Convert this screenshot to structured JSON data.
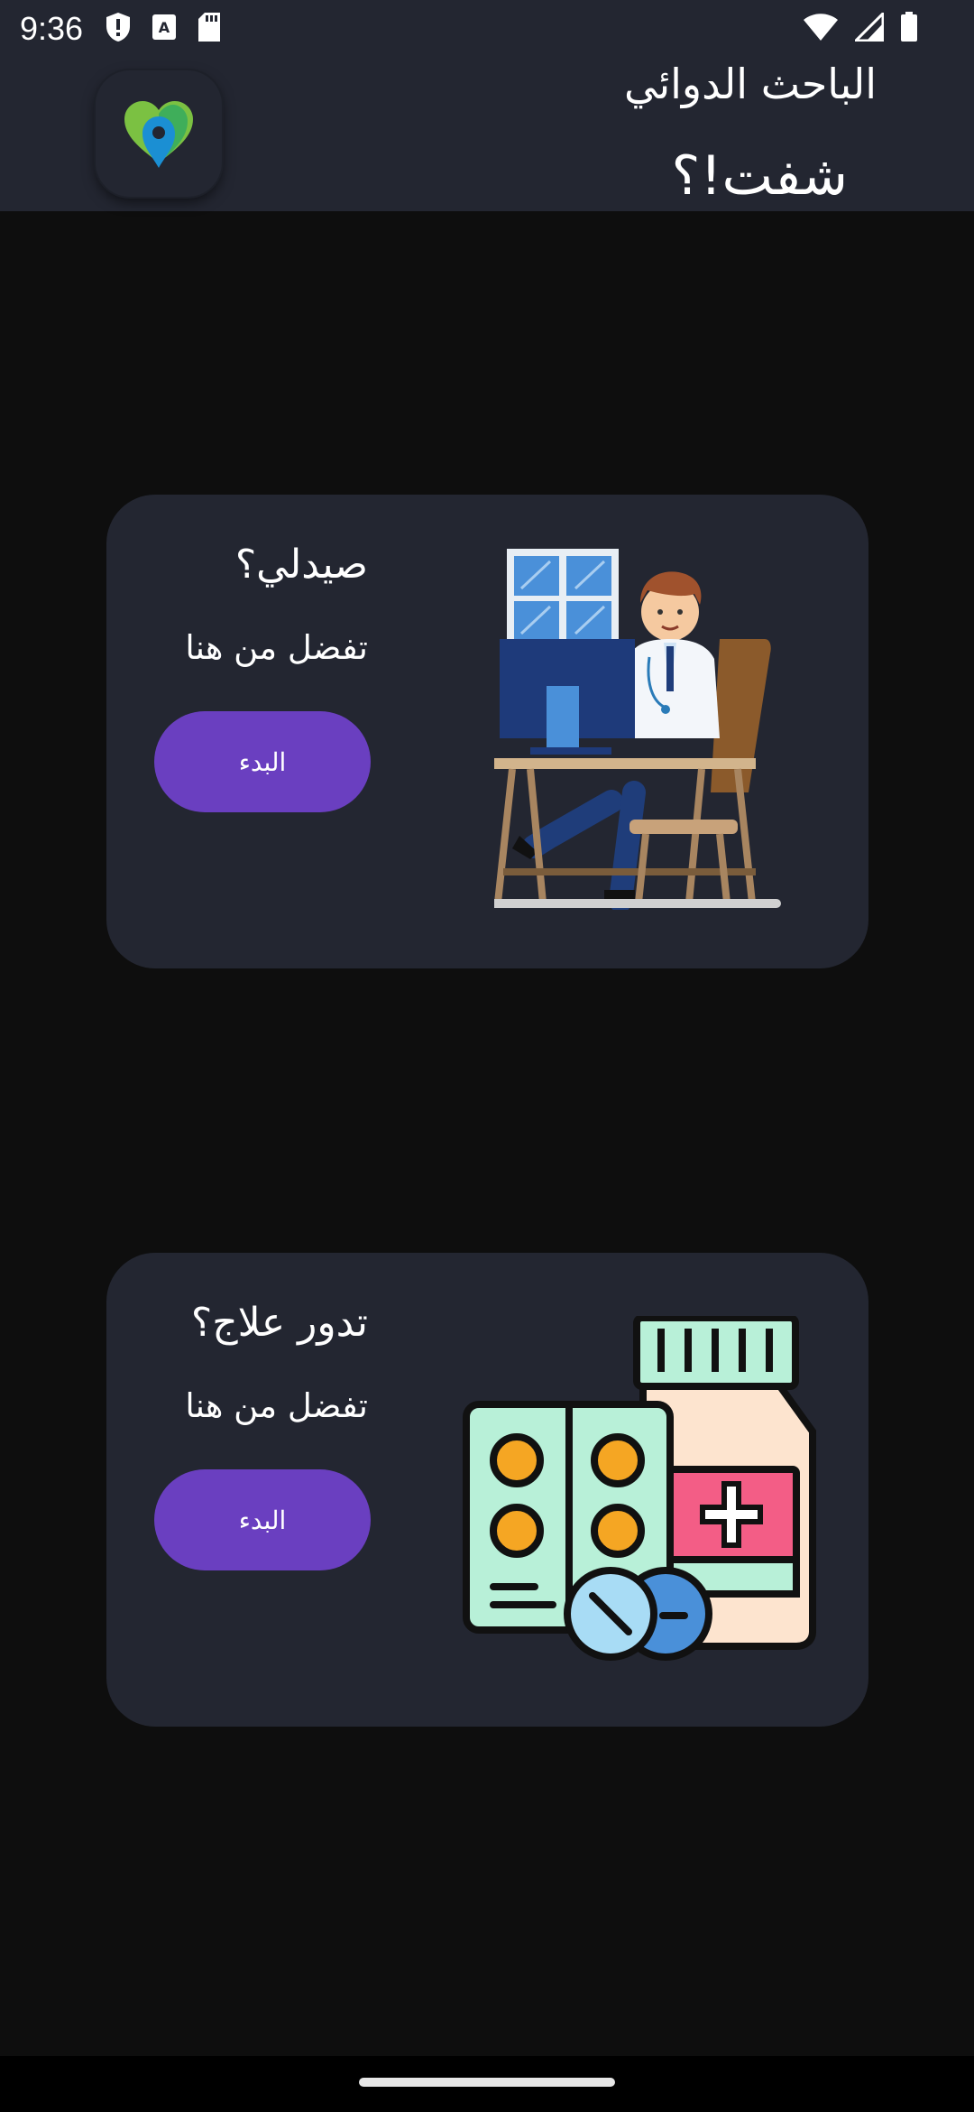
{
  "status_bar": {
    "time": "9:36",
    "left_icons": [
      "shield-icon",
      "font-a-icon",
      "sd-card-icon"
    ],
    "right_icons": [
      "wifi-icon",
      "signal-icon",
      "battery-icon"
    ]
  },
  "header": {
    "app_name": "الباحث الدوائي",
    "slogan": "شفت!؟",
    "logo": "location-pin-heart-logo"
  },
  "cards": [
    {
      "title": "صيدلي؟",
      "subtitle": "تفضل من هنا",
      "button_label": "البدء",
      "illustration": "pharmacist-at-desk-illustration"
    },
    {
      "title": "تدور علاج؟",
      "subtitle": "تفضل من هنا",
      "button_label": "البدء",
      "illustration": "medicine-bottle-and-pills-illustration"
    }
  ],
  "colors": {
    "background": "#0e0e0e",
    "surface": "#232631",
    "accent": "#6a3fc0"
  }
}
